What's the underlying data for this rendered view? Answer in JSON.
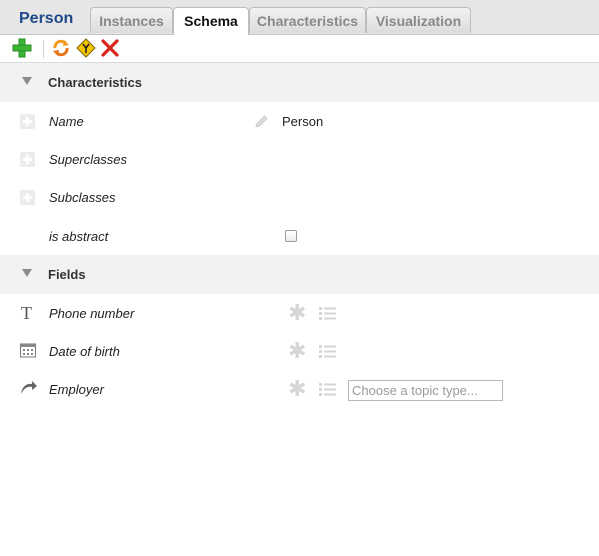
{
  "app": {
    "title": "Person"
  },
  "tabs": [
    {
      "label": "Instances",
      "active": false
    },
    {
      "label": "Schema",
      "active": true
    },
    {
      "label": "Characteristics",
      "active": false
    },
    {
      "label": "Visualization",
      "active": false
    }
  ],
  "toolbar": {
    "icons": [
      "add-icon",
      "refresh-icon",
      "merge-icon",
      "delete-icon"
    ]
  },
  "sections": {
    "characteristics": {
      "label": "Characteristics"
    },
    "fields": {
      "label": "Fields"
    }
  },
  "characteristics": {
    "name": {
      "label": "Name",
      "value": "Person"
    },
    "superclasses": {
      "label": "Superclasses"
    },
    "subclasses": {
      "label": "Subclasses"
    },
    "is_abstract": {
      "label": "is abstract",
      "checked": false
    }
  },
  "fields": [
    {
      "label": "Phone number",
      "icon": "text-icon"
    },
    {
      "label": "Date of birth",
      "icon": "calendar-icon"
    },
    {
      "label": "Employer",
      "icon": "association-arrow-icon"
    }
  ],
  "employer_input": {
    "placeholder": "Choose a topic type..."
  },
  "colors": {
    "title": "#1f4a8a",
    "header_bg": "#e6e6e6",
    "section_bg": "#f2f2f2",
    "add_green": "#3bb534",
    "delete_red": "#d9261c",
    "refresh_orange": "#f39a1e"
  }
}
